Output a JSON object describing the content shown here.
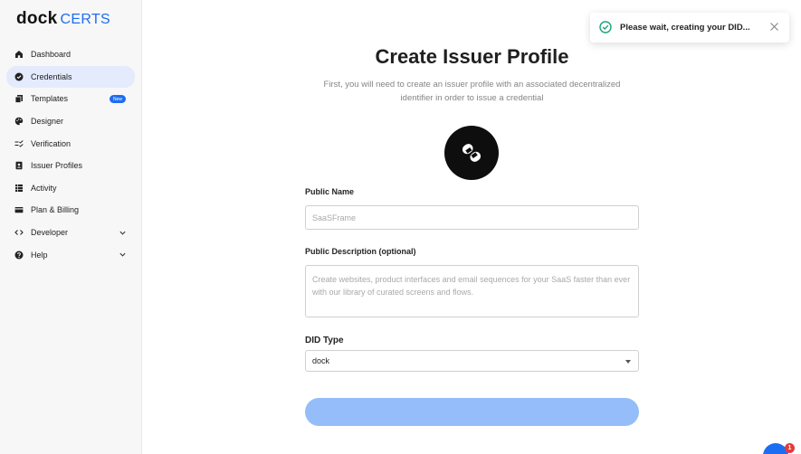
{
  "brand": {
    "name_part1": "dock",
    "name_part2": "CERTS",
    "accent": "#1d6df2"
  },
  "sidebar": {
    "items": [
      {
        "label": "Dashboard",
        "icon": "home-icon"
      },
      {
        "label": "Credentials",
        "icon": "verified-badge-icon",
        "active": true
      },
      {
        "label": "Templates",
        "icon": "copy-icon",
        "badge": "New"
      },
      {
        "label": "Designer",
        "icon": "palette-icon"
      },
      {
        "label": "Verification",
        "icon": "checklist-icon"
      },
      {
        "label": "Issuer Profiles",
        "icon": "contact-icon"
      },
      {
        "label": "Activity",
        "icon": "list-icon"
      },
      {
        "label": "Plan & Billing",
        "icon": "card-icon"
      },
      {
        "label": "Developer",
        "icon": "code-icon",
        "expandable": true
      },
      {
        "label": "Help",
        "icon": "help-icon",
        "expandable": true
      }
    ]
  },
  "main": {
    "title": "Create Issuer Profile",
    "subtitle": "First, you will need to create an issuer profile with an associated decentralized identifier in order to issue a credential",
    "public_name": {
      "label": "Public Name",
      "placeholder": "SaaSFrame"
    },
    "public_description": {
      "label": "Public Description (optional)",
      "placeholder": "Create websites, product interfaces and email sequences for your SaaS faster than ever with our library of curated screens and flows."
    },
    "did_type": {
      "label": "DID Type",
      "value": "dock"
    },
    "submit_label": ""
  },
  "toast": {
    "message": "Please wait, creating your DID...",
    "status_color": "#1aa37a"
  },
  "chat": {
    "badge_count": "1"
  }
}
